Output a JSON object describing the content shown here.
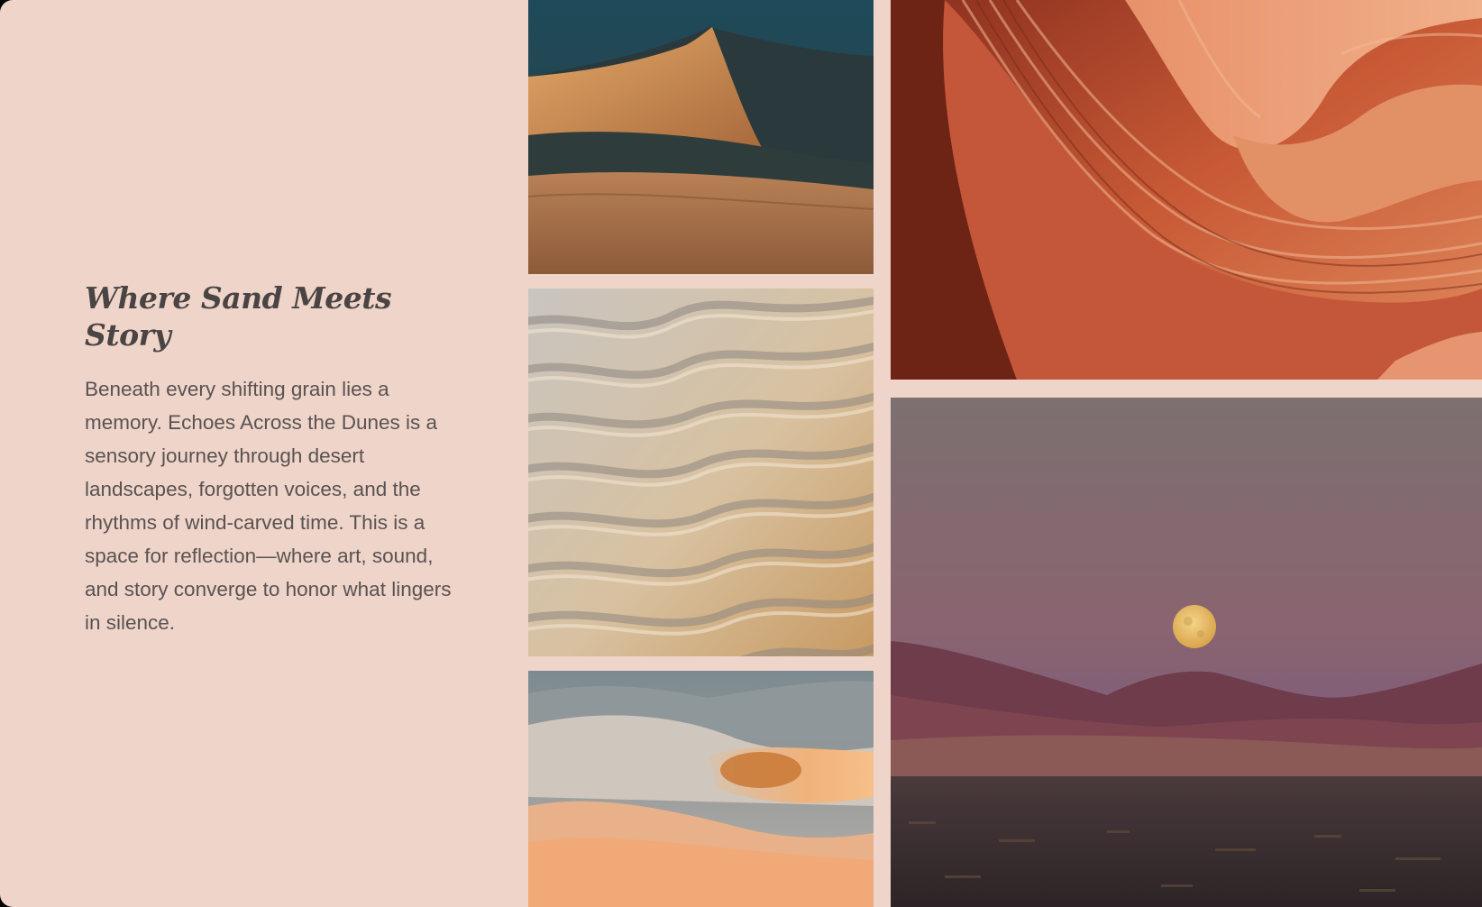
{
  "article": {
    "heading": "Where Sand Meets Story",
    "body": "Beneath every shifting grain lies a memory. Echoes Across the Dunes is a sensory journey through desert landscapes, forgotten voices, and the rhythms of wind-carved time. This is a space for reflection—where art, sound, and story converge to honor what lingers in silence."
  },
  "gallery": {
    "photos": [
      {
        "subject": "sand dunes in shadow"
      },
      {
        "subject": "rippled sand"
      },
      {
        "subject": "sunlit dunes"
      },
      {
        "subject": "red sandstone canyon"
      },
      {
        "subject": "full moon over desert mountains"
      }
    ]
  },
  "colors": {
    "background": "#efd5c9",
    "heading": "#4a4444",
    "body_text": "#595252"
  }
}
